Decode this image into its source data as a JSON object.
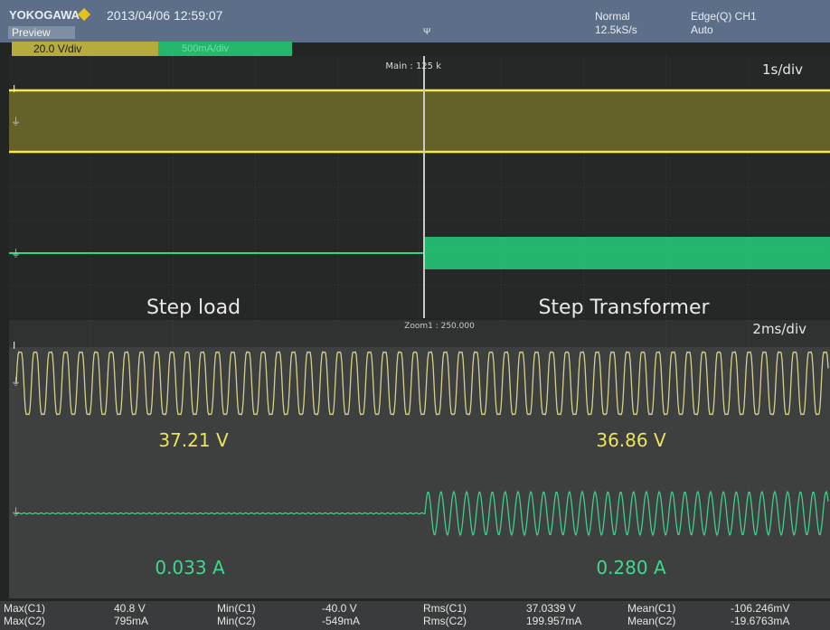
{
  "header": {
    "brand": "YOKOGAWA",
    "datetime": "2013/04/06  12:59:07",
    "preview": "Preview",
    "acq_mode": "Normal",
    "sample_rate": "12.5kS/s",
    "trigger": "Edge(Q) CH1",
    "trigger_mode": "Auto",
    "trigger_pos_marker": "Ψ",
    "colors": {
      "bar": "#5d6e88",
      "ch1": "#e7dd3a",
      "ch2": "#2bdc7b"
    }
  },
  "channels": {
    "ch1_setting": "20.0 V/div",
    "ch2_setting": "500mA/div"
  },
  "main_panel": {
    "label": "Main : 125 k",
    "timebase": "1s/div",
    "left_caption": "Step load",
    "right_caption": "Step Transformer"
  },
  "zoom_panel": {
    "label": "Zoom1 : 250.000",
    "timebase": "2ms/div",
    "voltage_left": "37.21 V",
    "voltage_right": "36.86 V",
    "current_left": "0.033 A",
    "current_right": "0.280 A"
  },
  "measurements": {
    "max_c1_label": "Max(C1)",
    "max_c1": "40.8 V",
    "max_c2_label": "Max(C2)",
    "max_c2": "795mA",
    "min_c1_label": "Min(C1)",
    "min_c1": "-40.0 V",
    "min_c2_label": "Min(C2)",
    "min_c2": "-549mA",
    "rms_c1_label": "Rms(C1)",
    "rms_c1": "37.0339 V",
    "rms_c2_label": "Rms(C2)",
    "rms_c2": "199.957mA",
    "mean_c1_label": "Mean(C1)",
    "mean_c1": "-106.246mV",
    "mean_c2_label": "Mean(C2)",
    "mean_c2": "-19.6763mA"
  }
}
